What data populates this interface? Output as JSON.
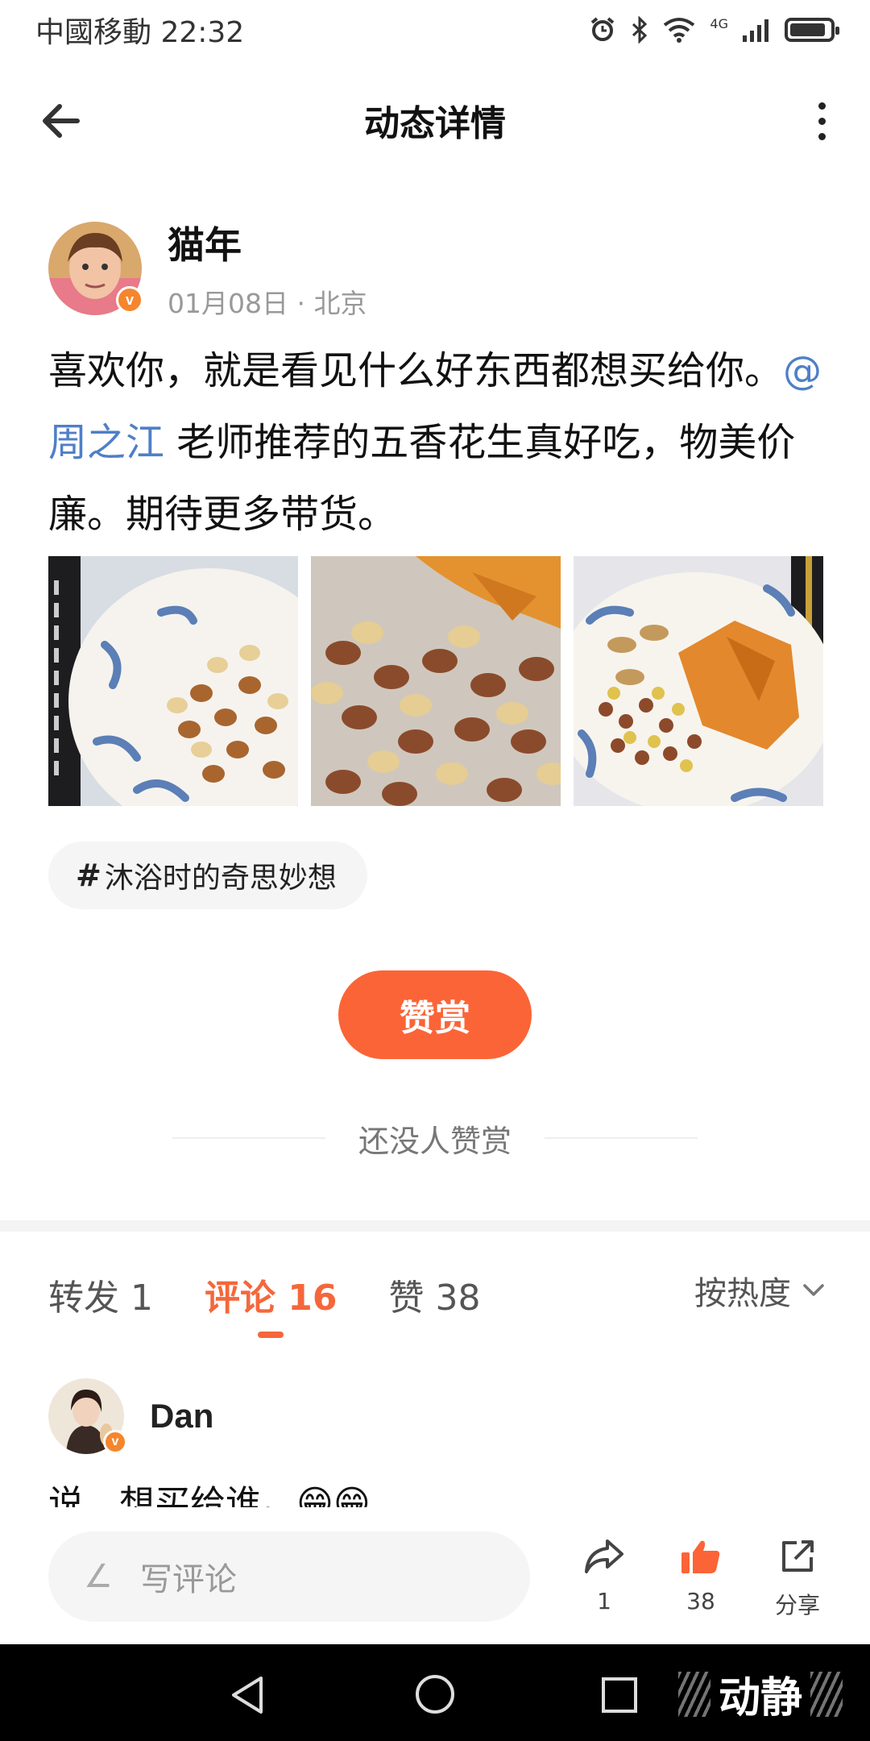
{
  "status_bar": {
    "carrier_time": "中國移動 22:32",
    "network": "4G"
  },
  "header": {
    "title": "动态详情"
  },
  "post": {
    "author": {
      "name": "猫年",
      "meta": "01月08日 · 北京",
      "badge": "v"
    },
    "text_before": "喜欢你，就是看见什么好东西都想买给你。",
    "mention": "@周之江",
    "text_after": " 老师推荐的五香花生真好吃，物美价廉。期待更多带货。",
    "photos": [
      "peanuts-plate-1",
      "peanuts-closeup",
      "peanuts-cashews-chips"
    ],
    "topic": {
      "hash": "#",
      "label": "沐浴时的奇思妙想"
    }
  },
  "reward": {
    "button_label": "赞赏",
    "empty_text": "还没人赞赏"
  },
  "tabs": [
    {
      "label": "转发 1",
      "active": false
    },
    {
      "label": "评论 16",
      "active": true
    },
    {
      "label": "赞 38",
      "active": false
    }
  ],
  "sort": {
    "label": "按热度"
  },
  "comments": [
    {
      "name": "Dan",
      "badge": "v",
      "text": "说，想买给谁。😁😁"
    }
  ],
  "action_bar": {
    "input_placeholder": "写评论",
    "repost_count": "1",
    "like_count": "38",
    "share_label": "分享"
  },
  "watermark": "动静",
  "colors": {
    "accent": "#f5673b",
    "reward": "#fb6437",
    "mention": "#4f7fc7",
    "badge": "#f5862d"
  }
}
